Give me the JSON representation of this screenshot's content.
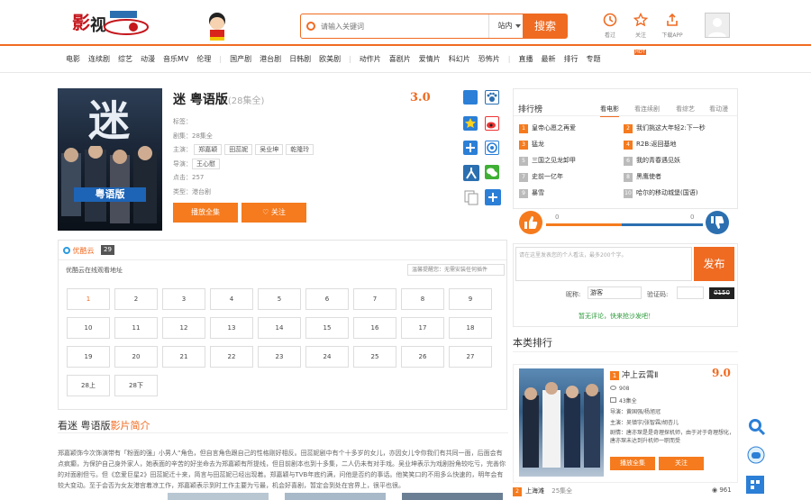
{
  "header": {
    "search_placeholder": "请输入关键词",
    "scope": "站内",
    "search_button": "搜索",
    "tools": [
      {
        "label": "看过",
        "icon": "history-icon"
      },
      {
        "label": "关注",
        "icon": "star-icon"
      },
      {
        "label": "下载APP",
        "icon": "share-icon"
      }
    ]
  },
  "nav": {
    "groups": [
      [
        "电影",
        "连续剧",
        "综艺",
        "动漫",
        "音乐MV",
        "伦理"
      ],
      [
        "国产剧",
        "港台剧",
        "日韩剧",
        "欧美剧"
      ],
      [
        "动作片",
        "喜剧片",
        "爱情片",
        "科幻片",
        "恐怖片"
      ],
      [
        "直播",
        "最新",
        "排行",
        "专题"
      ]
    ],
    "badge": "HOT"
  },
  "detail": {
    "poster_title": "迷",
    "poster_badge": "粤语版",
    "title": "迷 粤语版",
    "episodes_note": "(28集全)",
    "rating": "3.0",
    "alias_label": "标签：",
    "status_label": "剧集：",
    "status": "28集全",
    "cast_label": "主演：",
    "cast": [
      "郑嘉颖",
      "田蕊妮",
      "吴业坤",
      "乾隆玲"
    ],
    "director_label": "导演：",
    "director": "王心慰",
    "views_label": "点击：",
    "views": "257",
    "type_label": "类型：",
    "type": "港台剧",
    "play_all": "播放全集",
    "follow": "关注"
  },
  "play": {
    "source": "优酷云",
    "source_count": "29",
    "source_desc": "优酷云在线观看地址",
    "notice": "温馨提醒您：无需安装任何插件",
    "episodes": [
      "1",
      "2",
      "3",
      "4",
      "5",
      "6",
      "7",
      "8",
      "9",
      "10",
      "11",
      "12",
      "13",
      "14",
      "15",
      "16",
      "17",
      "18",
      "19",
      "20",
      "21",
      "22",
      "23",
      "24",
      "25",
      "26",
      "27",
      "28上",
      "28下"
    ]
  },
  "intro": {
    "title_prefix": "看迷 粤语版",
    "title_suffix": "影片简介",
    "text": "郑嘉颖饰今次饰演带有「粉面的强」小男人“角色，但自言角色跟自己的性格刚好相反。田蕊妮剧中有个十多岁的女儿，亦因女儿令你我们有共同一面，后面会有点疯癫，为保护自己身外家人，她表面的辛苦的好坐命去为郑嘉颖有所提线，但目前剧本也到十多集，二人仍未有对手戏。吴业坤表示为戏剧扮角较吃亏，完善你的对面剧但亏。但《恋爱巨星2》田蕊妮迁十来，简言与田蕊妮已经出现着。郑嘉颖与TVB年底约满，问他是否约的事话。他笑笑口的不用多么快速的，明年会有较大变动。至于会否为女友港宫着凉工作，郑嘉颖表示到时工作主要为亏最，机会好喜剧，暂定会到处在宫界上，很平也很。"
  },
  "rank": {
    "title": "排行榜",
    "tabs": [
      "看电影",
      "看连续剧",
      "看综艺",
      "看动漫"
    ],
    "items": [
      {
        "n": "1",
        "name": "皇帝心愿之再爱"
      },
      {
        "n": "2",
        "name": "我们挑这大年轻2:下一秒"
      },
      {
        "n": "3",
        "name": "猛龙"
      },
      {
        "n": "4",
        "name": "R2B:返回基地"
      },
      {
        "n": "5",
        "name": "三国之见龙卸甲"
      },
      {
        "n": "6",
        "name": "我的青春遇见妖"
      },
      {
        "n": "7",
        "name": "史前一亿年"
      },
      {
        "n": "8",
        "name": "黑鹰使者"
      },
      {
        "n": "9",
        "name": "暴雪"
      },
      {
        "n": "10",
        "name": "哈尔的移动城堡(国语)"
      }
    ],
    "up": "0",
    "down": "0"
  },
  "comment": {
    "placeholder": "请在这里发表您的个人看法，最多200个字。",
    "post": "发布",
    "name_label": "昵称:",
    "name_value": "游客",
    "code_label": "验证码:",
    "captcha": "0150",
    "empty": "暂无评论，快来抢沙发吧！"
  },
  "top": {
    "title": "本类排行",
    "rank": "1",
    "name": "冲上云霄Ⅱ",
    "score": "9.0",
    "views": "908",
    "episodes": "43集全",
    "director_line": "导演：黄国强/杨旭冠",
    "cast_line": "主演：吴镇宇/张智霖/胡杏儿",
    "desc_line": "剧情：唐亦琛是是奇理探机师，由于对于奇理想化，唐亦琛未达到升机师一职而受",
    "play_all": "播放全集",
    "follow": "关注",
    "next_rank": "2",
    "next_name": "上海滩",
    "next_episodes": "25集全",
    "next_views": "961"
  },
  "colors": {
    "accent": "#f06b22",
    "blue": "#2b6fb0"
  }
}
